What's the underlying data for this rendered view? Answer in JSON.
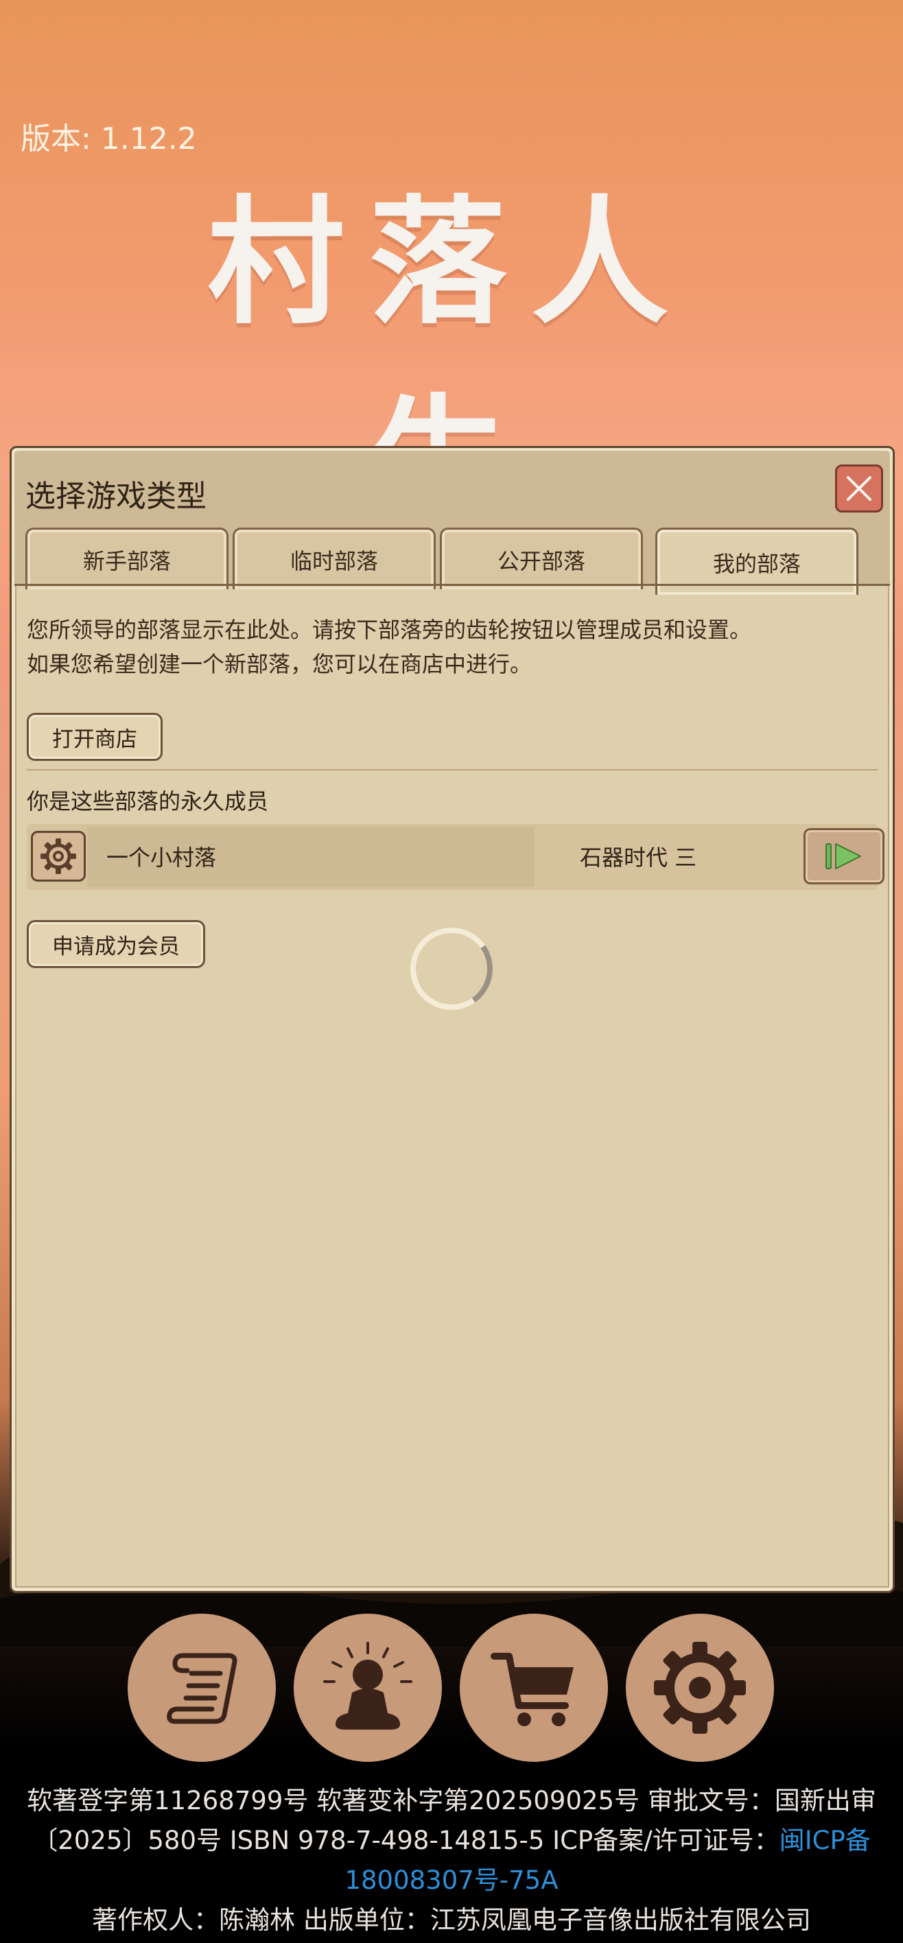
{
  "version_text": "版本: 1.12.2",
  "logo_text": "村落人生",
  "panel": {
    "title": "选择游戏类型",
    "tabs": [
      {
        "label": "新手部落",
        "active": false
      },
      {
        "label": "临时部落",
        "active": false
      },
      {
        "label": "公开部落",
        "active": false
      },
      {
        "label": "我的部落",
        "active": true
      }
    ],
    "description_line1": "您所领导的部落显示在此处。请按下部落旁的齿轮按钮以管理成员和设置。",
    "description_line2": "如果您希望创建一个新部落，您可以在商店中进行。",
    "open_shop_label": "打开商店",
    "permanent_member_label": "你是这些部落的永久成员",
    "tribes": [
      {
        "name": "一个小村落",
        "era": "石器时代 三"
      }
    ],
    "apply_member_label": "申请成为会员"
  },
  "bottom_buttons": [
    {
      "icon": "scroll-icon"
    },
    {
      "icon": "meditation-icon"
    },
    {
      "icon": "cart-icon"
    },
    {
      "icon": "gear-icon"
    }
  ],
  "footer": {
    "line1": "软著登字第11268799号 软著变补字第202509025号 审批文号：国新出审",
    "line2_prefix": "〔2025〕580号 ISBN 978-7-498-14815-5 ICP备案/许可证号：",
    "line2_link": "闽ICP备",
    "line3_link": "18008307号-75A",
    "line4": "著作权人：陈瀚林 出版单位：江苏凤凰电子音像出版社有限公司"
  },
  "colors": {
    "panel_bg": "#decfad",
    "close_button": "#d5735f",
    "link": "#2e8fd8",
    "round_button": "#c79a7a"
  }
}
